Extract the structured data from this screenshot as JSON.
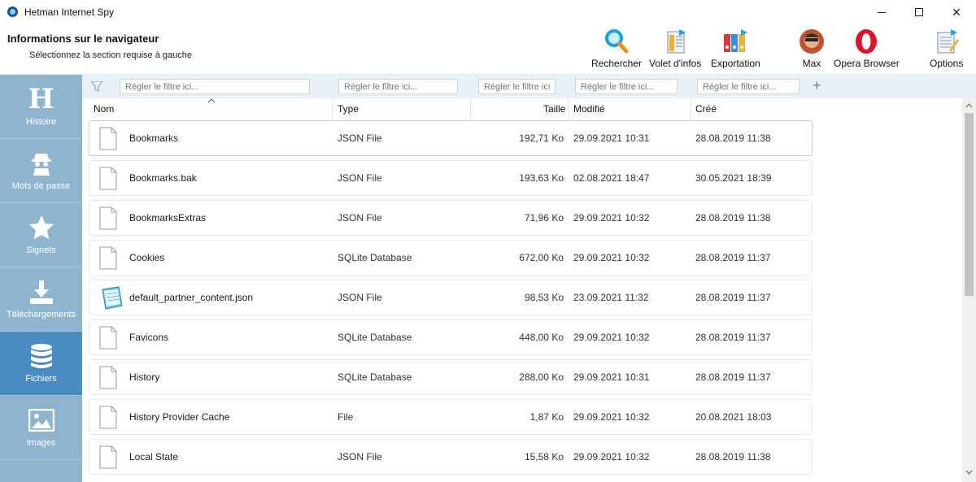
{
  "window": {
    "title": "Hetman Internet Spy",
    "controls": {
      "minimize": "minimize-icon",
      "maximize": "maximize-icon",
      "close": "✕"
    }
  },
  "header": {
    "title": "Informations sur le navigateur",
    "subtitle": "Sélectionnez la section requise à gauche"
  },
  "toolbar": {
    "search": "Rechercher",
    "info_pane": "Volet d'infos",
    "export": "Exportation",
    "user": "Max",
    "browser": "Opera Browser",
    "options": "Options"
  },
  "sidebar": {
    "items": [
      {
        "label": "Histoire",
        "icon": "history-h-icon"
      },
      {
        "label": "Mots de passe",
        "icon": "spy-icon"
      },
      {
        "label": "Signets",
        "icon": "star-icon"
      },
      {
        "label": "Téléchargements",
        "icon": "download-icon"
      },
      {
        "label": "Fichiers",
        "icon": "database-icon",
        "active": true
      },
      {
        "label": "Images",
        "icon": "image-icon"
      }
    ]
  },
  "filters": {
    "placeholder": "Régler le filtre ici...",
    "add": "+"
  },
  "columns": {
    "name": "Nom",
    "type": "Type",
    "size": "Taille",
    "modified": "Modifié",
    "created": "Créé"
  },
  "files": [
    {
      "name": "Bookmarks",
      "type": "JSON File",
      "size": "192,71 Ko",
      "modified": "29.09.2021 10:31",
      "created": "28.08.2019 11:38",
      "icon": "file-icon",
      "selected": true
    },
    {
      "name": "Bookmarks.bak",
      "type": "JSON File",
      "size": "193,63 Ko",
      "modified": "02.08.2021 18:47",
      "created": "30.05.2021 18:39",
      "icon": "file-icon"
    },
    {
      "name": "BookmarksExtras",
      "type": "JSON File",
      "size": "71,96 Ko",
      "modified": "29.09.2021 10:32",
      "created": "28.08.2019 11:38",
      "icon": "file-icon"
    },
    {
      "name": "Cookies",
      "type": "SQLite Database",
      "size": "672,00 Ko",
      "modified": "29.09.2021 10:32",
      "created": "28.08.2019 11:37",
      "icon": "file-icon"
    },
    {
      "name": "default_partner_content.json",
      "type": "JSON File",
      "size": "98,53 Ko",
      "modified": "23.09.2021 11:32",
      "created": "28.08.2019 11:37",
      "icon": "notepad-icon"
    },
    {
      "name": "Favicons",
      "type": "SQLite Database",
      "size": "448,00 Ko",
      "modified": "29.09.2021 10:32",
      "created": "28.08.2019 11:37",
      "icon": "file-icon"
    },
    {
      "name": "History",
      "type": "SQLite Database",
      "size": "288,00 Ko",
      "modified": "29.09.2021 10:31",
      "created": "28.08.2019 11:37",
      "icon": "file-icon"
    },
    {
      "name": "History Provider Cache",
      "type": "File",
      "size": "1,87 Ko",
      "modified": "29.09.2021 10:32",
      "created": "20.08.2021 18:03",
      "icon": "file-icon"
    },
    {
      "name": "Local State",
      "type": "JSON File",
      "size": "15,58 Ko",
      "modified": "29.09.2021 10:32",
      "created": "28.08.2019 11:38",
      "icon": "file-icon"
    }
  ]
}
